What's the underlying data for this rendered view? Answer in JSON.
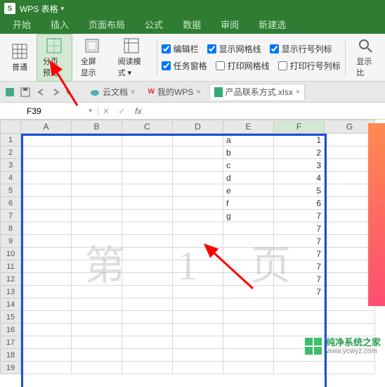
{
  "app": {
    "title": "WPS 表格",
    "logo": "S"
  },
  "menus": [
    "开始",
    "插入",
    "页面布局",
    "公式",
    "数据",
    "审阅",
    "新建选"
  ],
  "active_menu": -1,
  "ribbon": {
    "views": [
      {
        "label": "普通",
        "icon": "grid-icon"
      },
      {
        "label": "分页预览",
        "icon": "page-break-icon",
        "active": true
      },
      {
        "label": "全屏显示",
        "icon": "fullscreen-icon"
      },
      {
        "label": "阅读模式",
        "icon": "read-mode-icon",
        "dropdown": true
      }
    ],
    "checks_row1": [
      {
        "label": "编辑栏",
        "checked": true
      },
      {
        "label": "显示网格线",
        "checked": true
      },
      {
        "label": "显示行号列标",
        "checked": true
      }
    ],
    "checks_row2": [
      {
        "label": "任务窗格",
        "checked": true
      },
      {
        "label": "打印网格线",
        "checked": false
      },
      {
        "label": "打印行号列标",
        "checked": false
      }
    ],
    "right_label": "显示比"
  },
  "tabs": {
    "cloud": "云文档",
    "mywps": "我的WPS",
    "file": "产品联系方式.xlsx"
  },
  "namebox": "F39",
  "fx": "fx",
  "columns": [
    "A",
    "B",
    "C",
    "D",
    "E",
    "F",
    "G"
  ],
  "selected_col": "F",
  "rows": 19,
  "cells": {
    "E1": "a",
    "F1": "1",
    "E2": "b",
    "F2": "2",
    "E3": "c",
    "F3": "3",
    "E4": "d",
    "F4": "4",
    "E5": "e",
    "F5": "5",
    "E6": "f",
    "F6": "6",
    "E7": "g",
    "F7": "7",
    "F8": "7",
    "F9": "7",
    "F10": "7",
    "F11": "7",
    "F12": "7",
    "F13": "7"
  },
  "watermark": "第 1 页",
  "footer": {
    "cn": "纯净系统之家",
    "url": "www.ycwyz.com"
  },
  "colors": {
    "accent": "#2e7d32",
    "page_break": "#1b4fd1",
    "arrow": "#ff0000"
  }
}
